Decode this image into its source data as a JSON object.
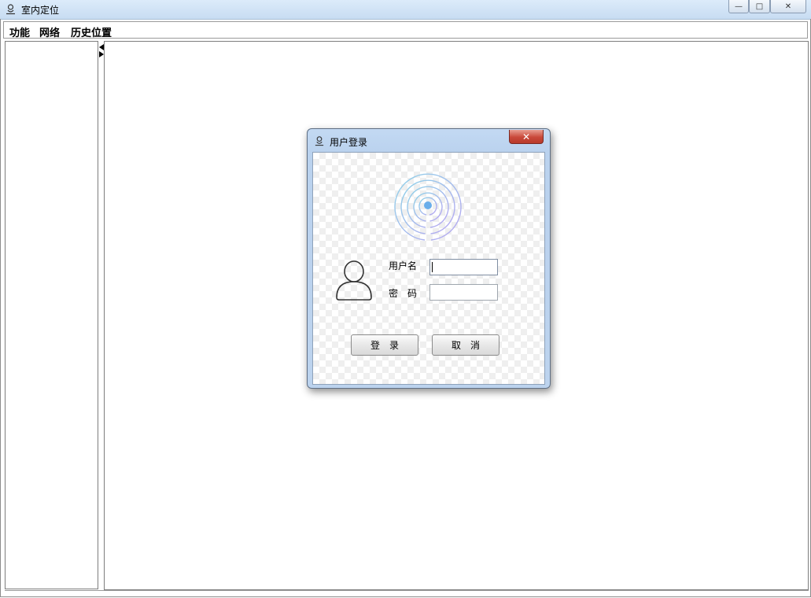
{
  "window": {
    "title": "室内定位",
    "icon": "location-user-icon",
    "controls": {
      "minimize": "—",
      "maximize": "□",
      "close": "✕"
    }
  },
  "menubar": {
    "items": [
      "功能",
      "网络",
      "历史位置"
    ]
  },
  "dialog": {
    "title": "用户登录",
    "icon": "location-user-icon",
    "close_glyph": "✕",
    "username_label": "用户名",
    "password_label": "密　码",
    "username_value": "",
    "password_value": "",
    "login_button": "登　录",
    "cancel_button": "取　消",
    "graphic": "wireless-signal-icon",
    "avatar": "user-avatar-icon"
  },
  "colors": {
    "titlebar": "#c7dcf2",
    "dialog_frame": "#bcd3ee",
    "close_red": "#c9493a",
    "signal_blue": "#7ab6ee",
    "signal_purple": "#b3a6f0"
  }
}
